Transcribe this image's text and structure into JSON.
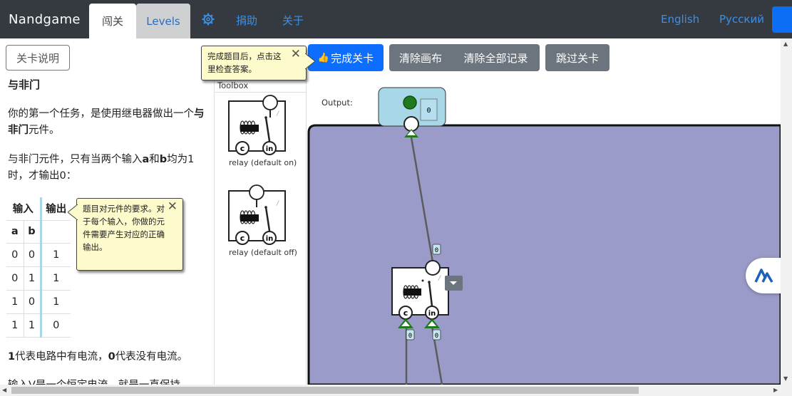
{
  "nav": {
    "brand": "Nandgame",
    "tab_active": "闯关",
    "tab_levels": "Levels",
    "donate": "捐助",
    "about": "关于",
    "lang_en": "English",
    "lang_ru": "Русский"
  },
  "help_button": "关卡说明",
  "description": {
    "title": "与非门",
    "p1_a": "你的第一个任务，是使用继电器做出一个",
    "p1_b": "与非门",
    "p1_c": "元件。",
    "p2_a": "与非门元件，只有当两个输入",
    "p2_b": "a",
    "p2_c": "和",
    "p2_d": "b",
    "p2_e": "均为1时，才输出0：",
    "p3_a": "1",
    "p3_b": "代表电路中有电流，",
    "p3_c": "0",
    "p3_d": "代表没有电流。",
    "p4": "输入V是一个恒定电流，就是一直保持"
  },
  "truth_table": {
    "header_input": "输入",
    "header_output": "输出",
    "col_a": "a",
    "col_b": "b",
    "rows": [
      [
        "0",
        "0",
        "1"
      ],
      [
        "0",
        "1",
        "1"
      ],
      [
        "1",
        "0",
        "1"
      ],
      [
        "1",
        "1",
        "0"
      ]
    ]
  },
  "tooltip_requirements": "题目对元件的要求。对于每个输入，你做的元件需要产生对应的正确输出。",
  "tooltip_check": "完成题目后，点击这里检查答案。",
  "buttons": {
    "complete": "完成关卡",
    "clear": "清除画布",
    "clear_all": "清除全部记录",
    "skip": "跳过关卡"
  },
  "toolbox": {
    "title": "Toolbox",
    "items": [
      {
        "label": "relay (default on)",
        "c_pin": "c",
        "in_pin": "in"
      },
      {
        "label": "relay (default off)",
        "c_pin": "c",
        "in_pin": "in"
      }
    ]
  },
  "canvas": {
    "output_label": "Output:",
    "output_value": "0",
    "wire_value_top": "0",
    "wire_value_c": "0",
    "wire_value_in": "0",
    "relay_c": "c",
    "relay_in": "in"
  },
  "colors": {
    "navbar": "#353a40",
    "primary": "#0d6efd",
    "secondary": "#6c757d",
    "canvas_bg": "#9a9bc8",
    "output_box": "#a8d8e8",
    "tooltip_bg": "#fdfbcb",
    "signal_green": "#1f7a1f"
  }
}
